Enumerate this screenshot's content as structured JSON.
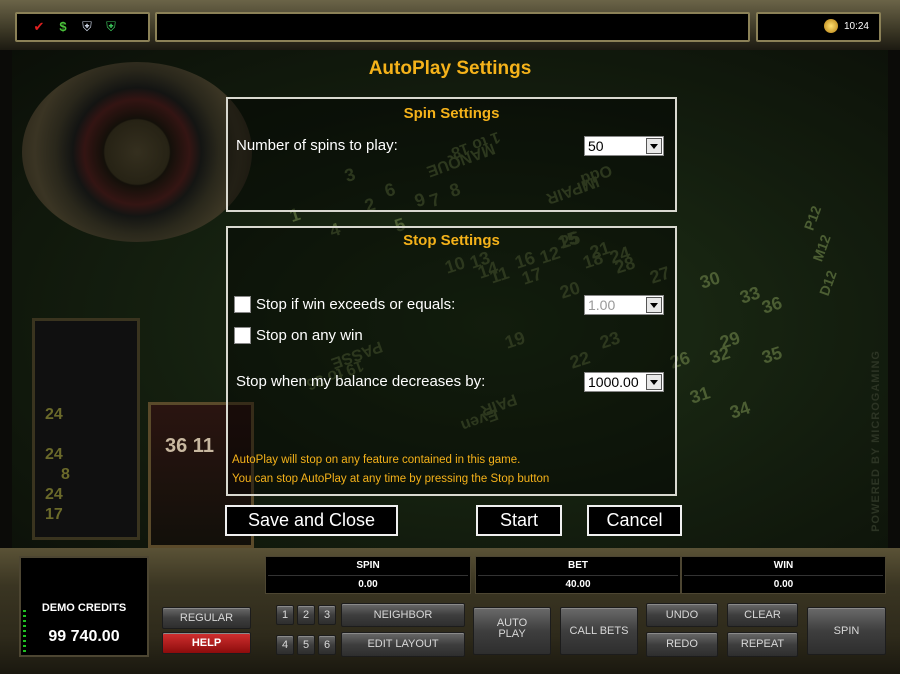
{
  "topbar": {
    "icons": [
      "checkmark-icon",
      "dollar-icon",
      "shield-icon",
      "shield-plus-icon"
    ],
    "clock": "10:24"
  },
  "table_bg": {
    "numbers": [
      "1",
      "4",
      "2",
      "5",
      "3",
      "6",
      "9",
      "8",
      "7",
      "13",
      "10",
      "16",
      "11",
      "14",
      "12",
      "15",
      "17",
      "18",
      "19",
      "20",
      "21",
      "22",
      "23",
      "24",
      "27",
      "30",
      "33",
      "36",
      "26",
      "29",
      "32",
      "35",
      "31",
      "34",
      "25",
      "28"
    ],
    "words": [
      "MANQUE",
      "1 to 18",
      "IMPAIR",
      "Odd",
      "PASSE",
      "19 to 36",
      "PAIR",
      "Even"
    ],
    "dozen_labels": [
      "P12",
      "M12",
      "D12"
    ],
    "history_numbers": [
      "24",
      "24",
      "8",
      "24",
      "17"
    ],
    "wheel2_numbers": "36 11",
    "brand": "POWERED BY MICROGAMING"
  },
  "dialog": {
    "title": "AutoPlay Settings",
    "spin_settings": {
      "title": "Spin Settings",
      "spins_label": "Number of spins to play:",
      "spins_value": "50"
    },
    "stop_settings": {
      "title": "Stop Settings",
      "win_exceeds_label": "Stop if win exceeds or equals:",
      "win_exceeds_value": "1.00",
      "win_exceeds_checked": false,
      "any_win_label": "Stop on any win",
      "any_win_checked": false,
      "balance_label": "Stop when my balance decreases by:",
      "balance_value": "1000.00",
      "note_line1": "AutoPlay will stop on any feature contained in this game.",
      "note_line2": "You can stop AutoPlay at any time by pressing the Stop button"
    },
    "buttons": {
      "save": "Save and Close",
      "start": "Start",
      "cancel": "Cancel"
    }
  },
  "console": {
    "credits_label": "DEMO CREDITS",
    "credits_value": "99 740.00",
    "spin_header": "SPIN",
    "spin_value": "0.00",
    "bet_header": "BET",
    "bet_value": "40.00",
    "win_header": "WIN",
    "win_value": "0.00",
    "regular": "REGULAR",
    "help": "HELP",
    "numbers": [
      "1",
      "2",
      "3",
      "4",
      "5",
      "6"
    ],
    "neighbor": "NEIGHBOR",
    "edit_layout": "EDIT LAYOUT",
    "auto_play_line1": "AUTO",
    "auto_play_line2": "PLAY",
    "call_bets": "CALL BETS",
    "undo": "UNDO",
    "redo": "REDO",
    "clear": "CLEAR",
    "repeat": "REPEAT",
    "spin": "SPIN"
  },
  "colors": {
    "accent_gold": "#f5b21a",
    "help_red": "#c01818",
    "felt_green": "#1e3016"
  }
}
